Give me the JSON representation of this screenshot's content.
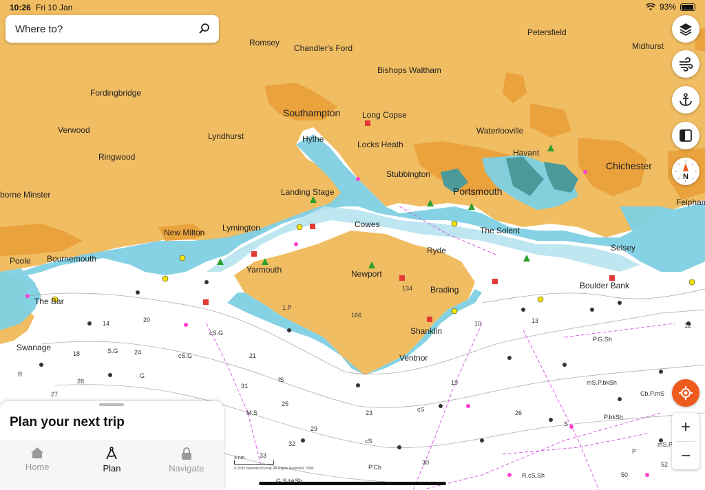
{
  "status": {
    "time": "10:26",
    "date": "Fri 10 Jan",
    "battery": "93%"
  },
  "search": {
    "placeholder": "Where to?"
  },
  "map": {
    "places": [
      {
        "name": "Romsey"
      },
      {
        "name": "Chandler's Ford"
      },
      {
        "name": "Petersfield"
      },
      {
        "name": "Midhurst"
      },
      {
        "name": "Bishops Waltham"
      },
      {
        "name": "Fordingbridge"
      },
      {
        "name": "Southampton"
      },
      {
        "name": "Long Copse"
      },
      {
        "name": "Verwood"
      },
      {
        "name": "Lyndhurst"
      },
      {
        "name": "Hythe"
      },
      {
        "name": "Locks Heath"
      },
      {
        "name": "Waterlooville"
      },
      {
        "name": "Ringwood"
      },
      {
        "name": "Havant"
      },
      {
        "name": "Chichester"
      },
      {
        "name": "Stubbington"
      },
      {
        "name": "Landing Stage"
      },
      {
        "name": "Portsmouth"
      },
      {
        "name": "borne Minster"
      },
      {
        "name": "Felpham"
      },
      {
        "name": "New Milton"
      },
      {
        "name": "Lymington"
      },
      {
        "name": "Cowes"
      },
      {
        "name": "The Solent"
      },
      {
        "name": "Selsey"
      },
      {
        "name": "Poole"
      },
      {
        "name": "Bournemouth"
      },
      {
        "name": "Ryde"
      },
      {
        "name": "Yarmouth"
      },
      {
        "name": "Newport"
      },
      {
        "name": "Boulder Bank"
      },
      {
        "name": "Brading"
      },
      {
        "name": "The Bar"
      },
      {
        "name": "Shanklin"
      },
      {
        "name": "Swanage"
      },
      {
        "name": "Ventnor"
      }
    ],
    "depths": [
      {
        "t": "134"
      },
      {
        "t": "166"
      },
      {
        "t": "14"
      },
      {
        "t": "20"
      },
      {
        "t": "10"
      },
      {
        "t": "13"
      },
      {
        "t": "12"
      },
      {
        "t": "18"
      },
      {
        "t": "24"
      },
      {
        "t": "21"
      },
      {
        "t": "28"
      },
      {
        "t": "27"
      },
      {
        "t": "31"
      },
      {
        "t": "25"
      },
      {
        "t": "23"
      },
      {
        "t": "29"
      },
      {
        "t": "32"
      },
      {
        "t": "33"
      },
      {
        "t": "30"
      },
      {
        "t": "19"
      },
      {
        "t": "26"
      },
      {
        "t": "52"
      },
      {
        "t": "50"
      },
      {
        "t": "cS.G"
      },
      {
        "t": "S.G"
      },
      {
        "t": "cS.G"
      },
      {
        "t": "fS"
      },
      {
        "t": "P.G.Sh"
      },
      {
        "t": "mS.P.bkSh"
      },
      {
        "t": "Cb.P.mS"
      },
      {
        "t": "P.bkSh"
      },
      {
        "t": "M.S"
      },
      {
        "t": "cS"
      },
      {
        "t": "P.Cb"
      },
      {
        "t": "R.cS.Sh"
      },
      {
        "t": "G.S.bkSh"
      },
      {
        "t": "mS.P"
      },
      {
        "t": "P"
      },
      {
        "t": "R"
      },
      {
        "t": "G"
      },
      {
        "t": "S"
      },
      {
        "t": "1.P"
      },
      {
        "t": "cS"
      }
    ],
    "scale_label": "3 nm",
    "copyright": "© 2025 Navionics Group. All Rights Reserved. OSM"
  },
  "controls": {
    "layers": "layers-icon",
    "wind": "wind-icon",
    "anchor": "anchor-icon",
    "panel": "panel-icon",
    "compass_label": "N"
  },
  "zoom": {
    "in": "+",
    "out": "−"
  },
  "sheet": {
    "title": "Plan your next trip"
  },
  "tabs": [
    {
      "label": "Home"
    },
    {
      "label": "Plan"
    },
    {
      "label": "Navigate"
    }
  ],
  "colors": {
    "land": "#f1bd62",
    "urban": "#e9a23c",
    "shallow": "#7fd0e3",
    "mid": "#b6e3ef",
    "deep": "#ffffff",
    "accent": "#ef5a1f"
  }
}
